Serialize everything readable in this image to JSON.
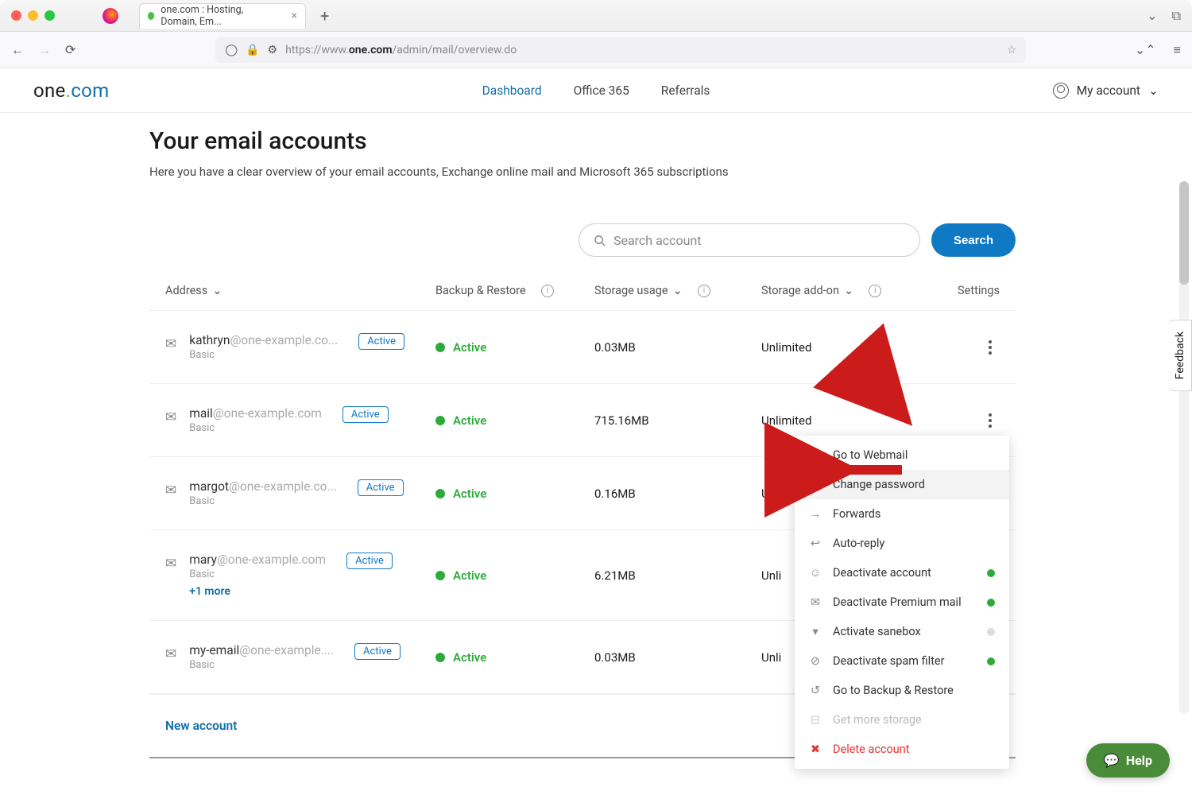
{
  "browser": {
    "tab_title": "one.com : Hosting, Domain, Em...",
    "url_host": "one.com",
    "url_prefix": "https://www.",
    "url_path": "/admin/mail/overview.do"
  },
  "header": {
    "logo_a": "one",
    "logo_b": "com",
    "nav": {
      "dashboard": "Dashboard",
      "office": "Office 365",
      "referrals": "Referrals"
    },
    "account_label": "My account"
  },
  "page": {
    "title": "Your email accounts",
    "subtitle": "Here you have a clear overview of your email accounts, Exchange online mail and Microsoft 365 subscriptions"
  },
  "search": {
    "placeholder": "Search account",
    "button": "Search"
  },
  "columns": {
    "address": "Address",
    "backup": "Backup & Restore",
    "storage_usage": "Storage usage",
    "storage_addon": "Storage add-on",
    "settings": "Settings"
  },
  "rows": [
    {
      "local": "kathryn",
      "domain": "@one-example.co...",
      "plan": "Basic",
      "badge": "Active",
      "status": "Active",
      "usage": "0.03MB",
      "addon": "Unlimited",
      "plus": ""
    },
    {
      "local": "mail",
      "domain": "@one-example.com",
      "plan": "Basic",
      "badge": "Active",
      "status": "Active",
      "usage": "715.16MB",
      "addon": "Unlimited",
      "plus": ""
    },
    {
      "local": "margot",
      "domain": "@one-example.co...",
      "plan": "Basic",
      "badge": "Active",
      "status": "Active",
      "usage": "0.16MB",
      "addon": "Unlim",
      "plus": ""
    },
    {
      "local": "mary",
      "domain": "@one-example.com",
      "plan": "Basic",
      "badge": "Active",
      "status": "Active",
      "usage": "6.21MB",
      "addon": "Unli",
      "plus": "+1 more"
    },
    {
      "local": "my-email",
      "domain": "@one-example....",
      "plan": "Basic",
      "badge": "Active",
      "status": "Active",
      "usage": "0.03MB",
      "addon": "Unli",
      "plus": ""
    }
  ],
  "new_account": "New account",
  "menu": {
    "webmail": "Go to Webmail",
    "change_pw": "Change password",
    "forwards": "Forwards",
    "autoreply": "Auto-reply",
    "deact_acct": "Deactivate account",
    "deact_prem": "Deactivate Premium mail",
    "act_sanebox": "Activate sanebox",
    "deact_spam": "Deactivate spam filter",
    "backup": "Go to Backup & Restore",
    "get_storage": "Get more storage",
    "delete": "Delete account"
  },
  "feedback": "Feedback",
  "help": "Help"
}
